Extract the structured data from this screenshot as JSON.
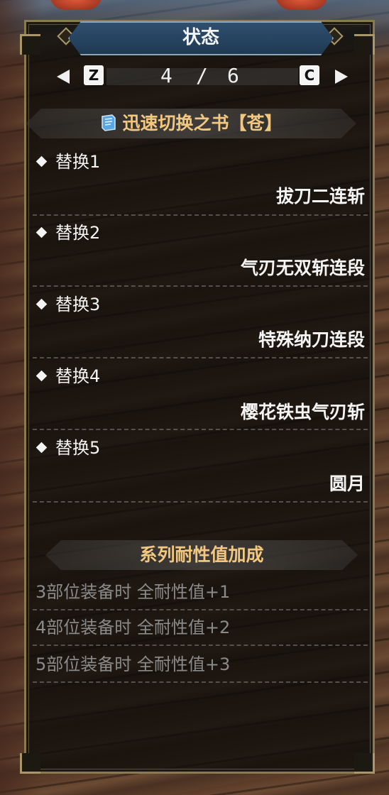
{
  "title": "状态",
  "pager": {
    "prev_key": "Z",
    "next_key": "C",
    "current": "4",
    "separator": "/",
    "total": "6"
  },
  "section1": {
    "icon": "book-icon",
    "title": "迅速切换之书【苍】",
    "items": [
      {
        "label": "替换1",
        "value": "拔刀二连斩"
      },
      {
        "label": "替换2",
        "value": "气刃无双斩连段"
      },
      {
        "label": "替换3",
        "value": "特殊纳刀连段"
      },
      {
        "label": "替换4",
        "value": "樱花铁虫气刃斩"
      },
      {
        "label": "替换5",
        "value": "圆月"
      }
    ]
  },
  "section2": {
    "title": "系列耐性值加成",
    "items": [
      "3部位装备时 全耐性值+1",
      "4部位装备时 全耐性值+2",
      "5部位装备时 全耐性值+3"
    ]
  },
  "colors": {
    "header_gold": "#f2c77f",
    "text_white": "#f4f4f4",
    "text_dim": "#8a8a8a",
    "title_blue": "#2f4f6e"
  }
}
